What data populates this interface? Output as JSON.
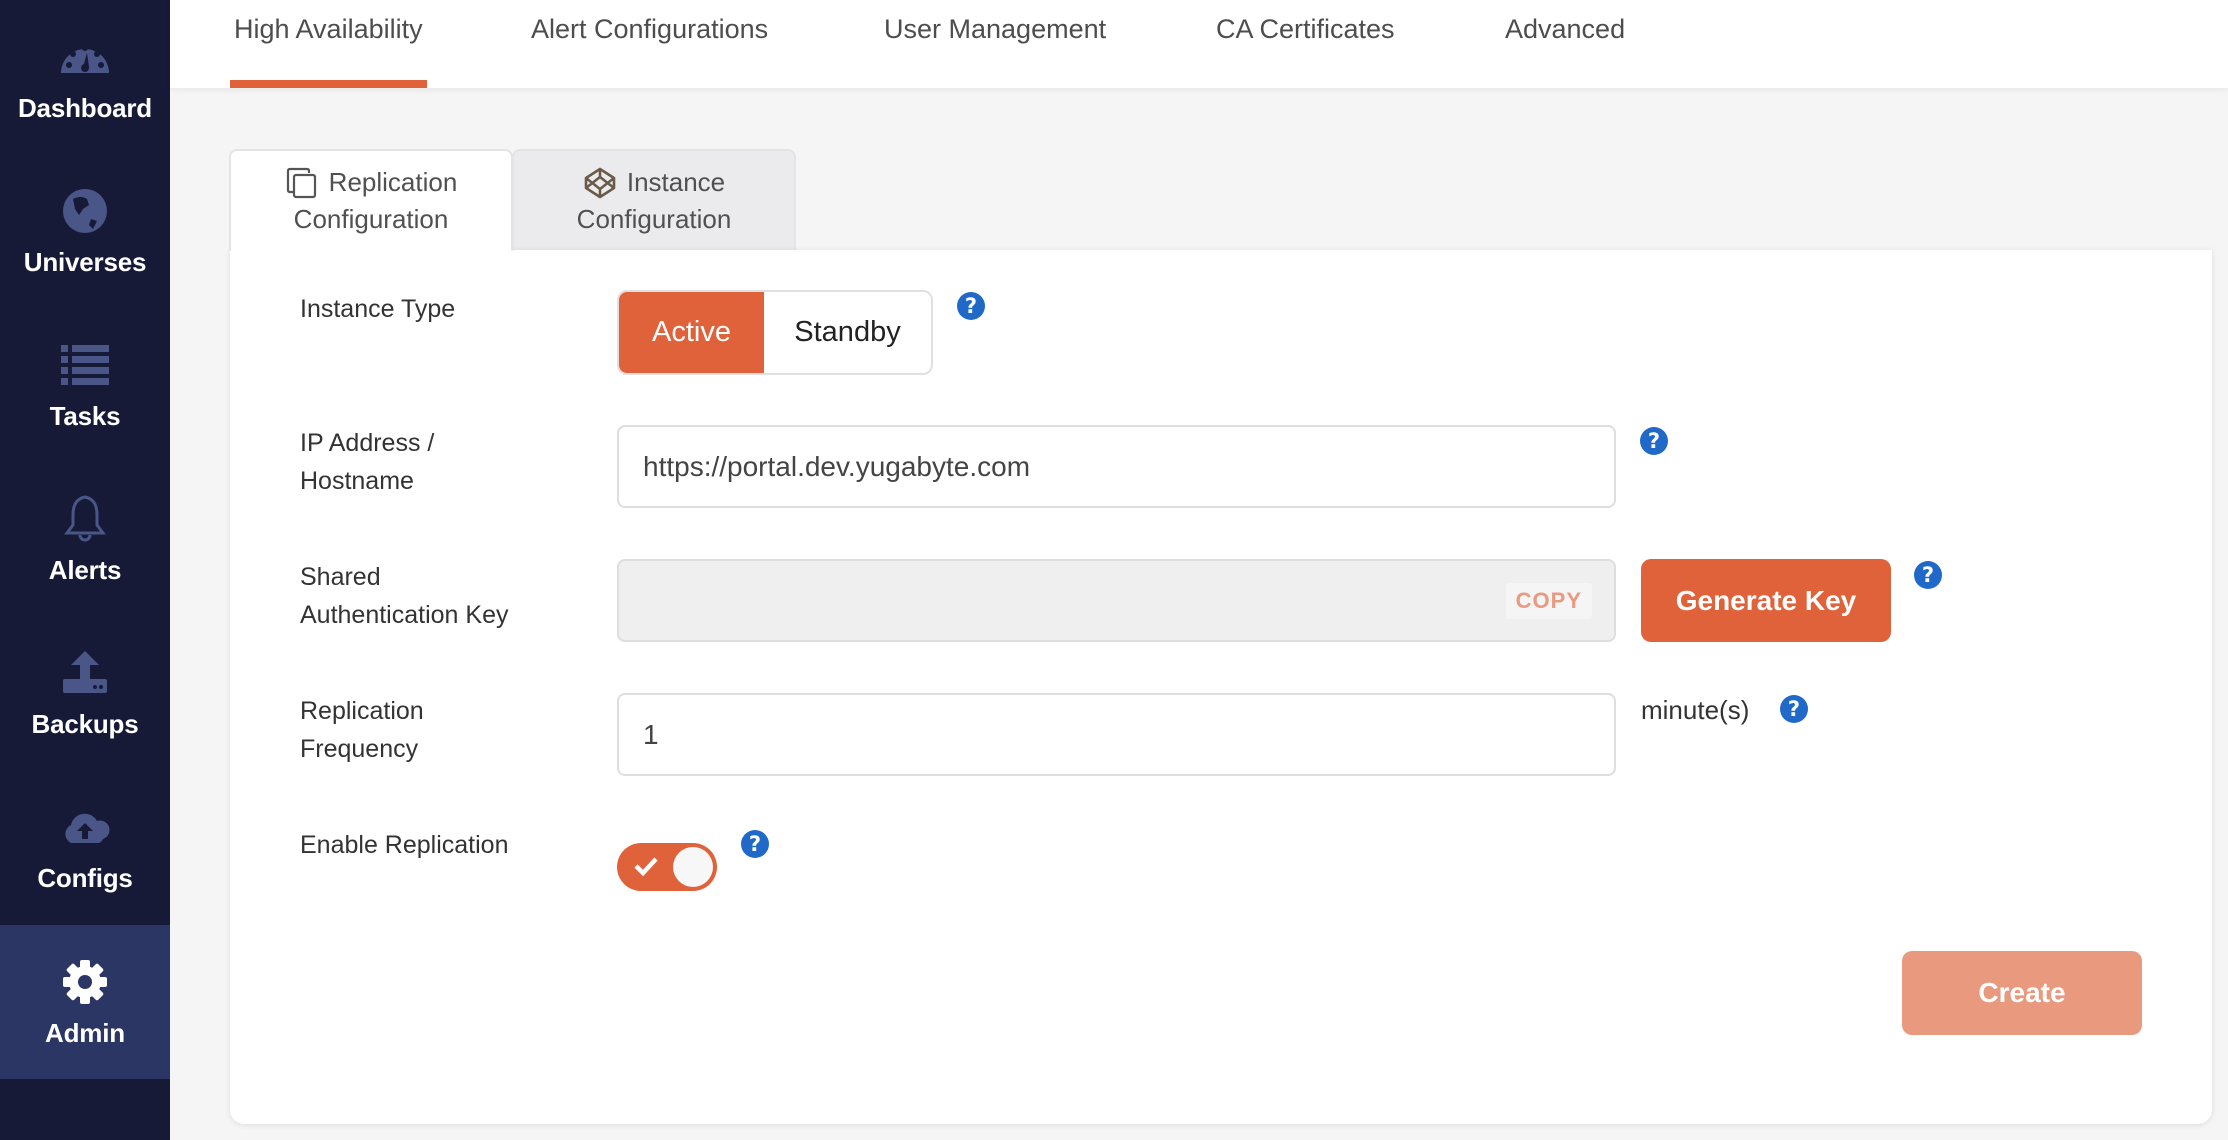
{
  "sidebar": {
    "items": [
      {
        "label": "Dashboard",
        "icon": "dashboard-gauge-icon",
        "active": false
      },
      {
        "label": "Universes",
        "icon": "globe-icon",
        "active": false
      },
      {
        "label": "Tasks",
        "icon": "list-icon",
        "active": false
      },
      {
        "label": "Alerts",
        "icon": "bell-icon",
        "active": false
      },
      {
        "label": "Backups",
        "icon": "upload-icon",
        "active": false
      },
      {
        "label": "Configs",
        "icon": "cloud-upload-icon",
        "active": false
      },
      {
        "label": "Admin",
        "icon": "gear-icon",
        "active": true
      }
    ]
  },
  "top_tabs": [
    {
      "label": "High Availability",
      "active": true
    },
    {
      "label": "Alert Configurations",
      "active": false
    },
    {
      "label": "User Management",
      "active": false
    },
    {
      "label": "CA Certificates",
      "active": false
    },
    {
      "label": "Advanced",
      "active": false
    }
  ],
  "sub_tabs": [
    {
      "line1": "Replication",
      "line2": "Configuration",
      "icon": "copy-icon",
      "active": true
    },
    {
      "line1": "Instance",
      "line2": "Configuration",
      "icon": "codepen-icon",
      "active": false
    }
  ],
  "form": {
    "instance_type": {
      "label": "Instance Type",
      "options": [
        "Active",
        "Standby"
      ],
      "selected": "Active"
    },
    "ip_address": {
      "label_line1": "IP Address /",
      "label_line2": "Hostname",
      "value": "https://portal.dev.yugabyte.com"
    },
    "shared_key": {
      "label_line1": "Shared",
      "label_line2": "Authentication Key",
      "value": "",
      "copy_label": "COPY",
      "generate_label": "Generate Key"
    },
    "frequency": {
      "label_line1": "Replication",
      "label_line2": "Frequency",
      "value": "1",
      "unit": "minute(s)"
    },
    "enable_replication": {
      "label": "Enable Replication",
      "checked": true
    },
    "create_label": "Create",
    "help_glyph": "?"
  },
  "colors": {
    "accent": "#e0623a",
    "sidebar_bg": "#161a36",
    "sidebar_active": "#2b3665",
    "help_blue": "#2069c8",
    "create_disabled": "#e99a7e"
  }
}
